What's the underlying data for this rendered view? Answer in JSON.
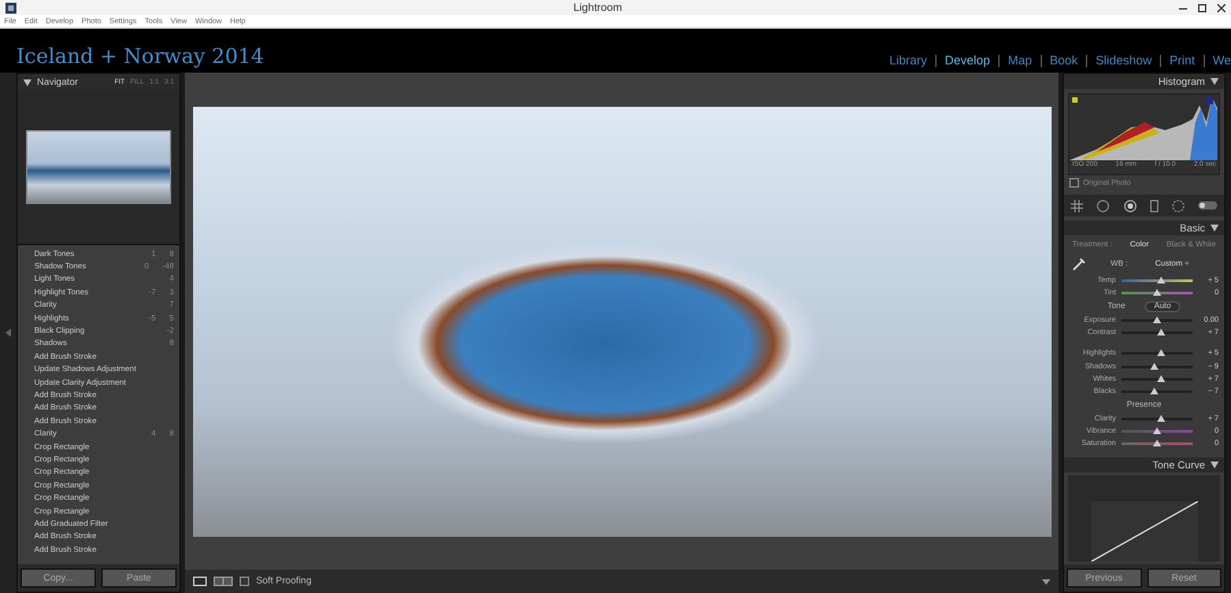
{
  "window": {
    "title": "Lightroom"
  },
  "menu": [
    "File",
    "Edit",
    "Develop",
    "Photo",
    "Settings",
    "Tools",
    "View",
    "Window",
    "Help"
  ],
  "identity_plate": "Iceland + Norway 2014",
  "modules": [
    {
      "label": "Library",
      "selected": false
    },
    {
      "label": "Develop",
      "selected": true
    },
    {
      "label": "Map",
      "selected": false
    },
    {
      "label": "Book",
      "selected": false
    },
    {
      "label": "Slideshow",
      "selected": false
    },
    {
      "label": "Print",
      "selected": false
    },
    {
      "label": "We",
      "selected": false
    }
  ],
  "navigator": {
    "title": "Navigator",
    "zoom_options": [
      {
        "label": "FIT",
        "selected": true
      },
      {
        "label": "FILL",
        "selected": false
      },
      {
        "label": "1:1",
        "selected": false
      },
      {
        "label": "3:1",
        "selected": false
      }
    ]
  },
  "history": [
    {
      "name": "Dark Tones",
      "values": [
        "1",
        "8"
      ]
    },
    {
      "name": "Shadow Tones",
      "values": [
        "0",
        "-48"
      ]
    },
    {
      "name": "Light Tones",
      "values": [
        "4"
      ]
    },
    {
      "name": "Highlight Tones",
      "values": [
        "-7",
        "3"
      ]
    },
    {
      "name": "Clarity",
      "values": [
        "7"
      ]
    },
    {
      "name": "Highlights",
      "values": [
        "-5",
        "5"
      ]
    },
    {
      "name": "Black Clipping",
      "values": [
        "-2"
      ]
    },
    {
      "name": "Shadows",
      "values": [
        "8"
      ]
    },
    {
      "name": "Add Brush Stroke"
    },
    {
      "name": "Update Shadows Adjustment"
    },
    {
      "name": "Update Clarity Adjustment"
    },
    {
      "name": "Add Brush Stroke"
    },
    {
      "name": "Add Brush Stroke"
    },
    {
      "name": "Add Brush Stroke"
    },
    {
      "name": "Clarity",
      "values": [
        "4",
        "8"
      ]
    },
    {
      "name": "Crop Rectangle"
    },
    {
      "name": "Crop Rectangle"
    },
    {
      "name": "Crop Rectangle"
    },
    {
      "name": "Crop Rectangle"
    },
    {
      "name": "Crop Rectangle"
    },
    {
      "name": "Crop Rectangle"
    },
    {
      "name": "Add Graduated Filter"
    },
    {
      "name": "Add Brush Stroke"
    },
    {
      "name": "Add Brush Stroke"
    }
  ],
  "left_buttons": [
    "Copy...",
    "Paste"
  ],
  "toolbar": {
    "soft_proofing": {
      "label": "Soft Proofing",
      "checked": false
    }
  },
  "histogram": {
    "title": "Histogram",
    "info": [
      "ISO 200",
      "16 mm",
      "f / 10.0",
      "2.0 sec"
    ],
    "original_photo": {
      "label": "Original Photo",
      "checked": false
    }
  },
  "basic": {
    "title": "Basic",
    "treatment_label": "Treatment :",
    "treatments": [
      {
        "label": "Color",
        "selected": true
      },
      {
        "label": "Black & White",
        "selected": false
      }
    ],
    "wb_label": "WB :",
    "wb_value": "Custom ÷",
    "rows": [
      {
        "kind": "temp",
        "label": "Temp",
        "level": 0.55,
        "reading": "+ 5"
      },
      {
        "kind": "tint",
        "label": "Tint",
        "level": 0.5,
        "reading": "0"
      },
      {
        "kind": "heading",
        "label": "Tone",
        "button": "Auto"
      },
      {
        "kind": "slider",
        "label": "Exposure",
        "level": 0.5,
        "reading": "0.00"
      },
      {
        "kind": "slider",
        "label": "Contrast",
        "level": 0.55,
        "reading": "+ 7"
      },
      {
        "kind": "gap"
      },
      {
        "kind": "slider",
        "label": "Highlights",
        "level": 0.55,
        "reading": "+ 5"
      },
      {
        "kind": "slider",
        "label": "Shadows",
        "level": 0.47,
        "reading": "− 9"
      },
      {
        "kind": "slider",
        "label": "Whites",
        "level": 0.55,
        "reading": "+ 7"
      },
      {
        "kind": "slider",
        "label": "Blacks",
        "level": 0.47,
        "reading": "− 7"
      },
      {
        "kind": "heading",
        "label": "Presence"
      },
      {
        "kind": "slider",
        "label": "Clarity",
        "level": 0.55,
        "reading": "+ 7"
      },
      {
        "kind": "vibrance",
        "label": "Vibrance",
        "level": 0.5,
        "reading": "0"
      },
      {
        "kind": "saturation",
        "label": "Saturation",
        "level": 0.5,
        "reading": "0"
      }
    ]
  },
  "tone_curve": {
    "title": "Tone Curve"
  },
  "right_buttons": [
    "Previous",
    "Reset"
  ]
}
